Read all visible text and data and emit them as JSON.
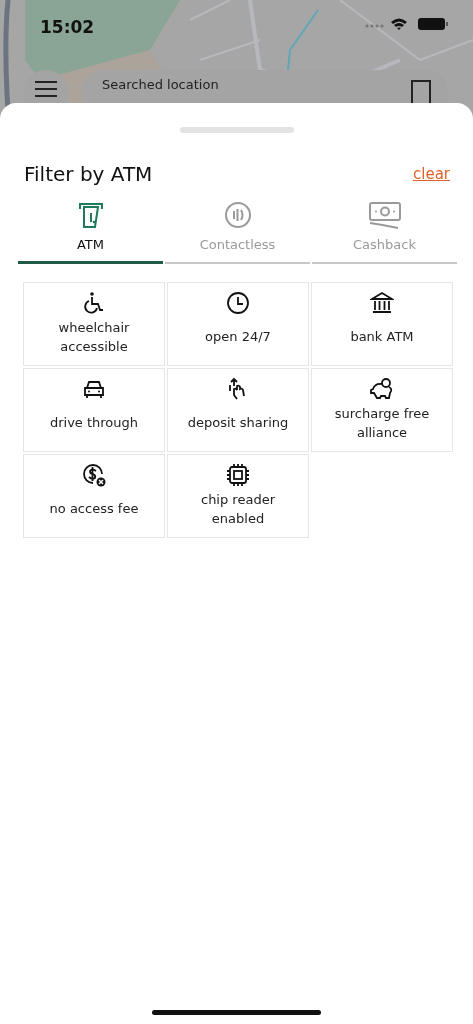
{
  "status_bar": {
    "time": "15:02"
  },
  "search_card": {
    "label": "Searched location"
  },
  "sheet": {
    "title": "Filter by ATM",
    "clear": "clear"
  },
  "tabs": [
    {
      "label": "ATM",
      "selected": true
    },
    {
      "label": "Contactless",
      "selected": false
    },
    {
      "label": "Cashback",
      "selected": false
    }
  ],
  "filters": [
    {
      "label": "wheelchair accessible"
    },
    {
      "label": "open 24/7"
    },
    {
      "label": "bank ATM"
    },
    {
      "label": "drive through"
    },
    {
      "label": "deposit sharing"
    },
    {
      "label": "surcharge free alliance"
    },
    {
      "label": "no access fee"
    },
    {
      "label": "chip reader enabled"
    }
  ]
}
